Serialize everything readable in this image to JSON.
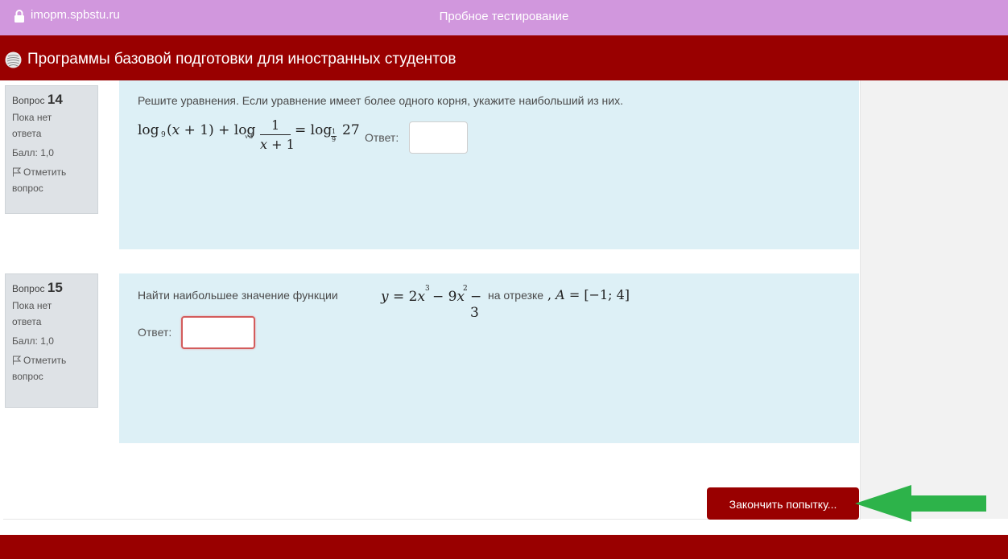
{
  "browser": {
    "url": "imopm.spbstu.ru",
    "title": "Пробное тестирование"
  },
  "site": {
    "title": "Программы базовой подготовки для иностранных студентов"
  },
  "questions": [
    {
      "label": "Вопрос",
      "number": "14",
      "status": "Пока нет ответа",
      "status_line1": "Пока нет",
      "status_line2": "ответа",
      "grade": "Балл: 1,0",
      "flag_line1": "Отметить",
      "flag_line2": "вопрос",
      "text": "Решите уравнения. Если уравнение имеет более одного корня, укажите наибольший из них.",
      "formula": "log₉(x+1) + log√3 (1/(x+1)) = log1/9 27",
      "answer_label": "Ответ:",
      "answer_value": ""
    },
    {
      "label": "Вопрос",
      "number": "15",
      "status": "Пока нет ответа",
      "status_line1": "Пока нет",
      "status_line2": "ответа",
      "grade": "Балл: 1,0",
      "flag_line1": "Отметить",
      "flag_line2": "вопрос",
      "text_prefix": "Найти наибольшее значение функции",
      "formula": "y = 2x³ − 9x² − 3",
      "text_middle": "на отрезке",
      "interval": "A = [−1; 4]",
      "answer_label": "Ответ:",
      "answer_value": ""
    }
  ],
  "actions": {
    "finish_label": "Закончить попытку..."
  },
  "colors": {
    "browser_bar": "#d197dd",
    "brand_red": "#990000",
    "question_bg": "#ddf0f6",
    "info_bg": "#dee2e6",
    "arrow": "#2db34a"
  },
  "icons": [
    "lock-icon",
    "site-logo-icon",
    "flag-icon",
    "arrow-icon"
  ]
}
